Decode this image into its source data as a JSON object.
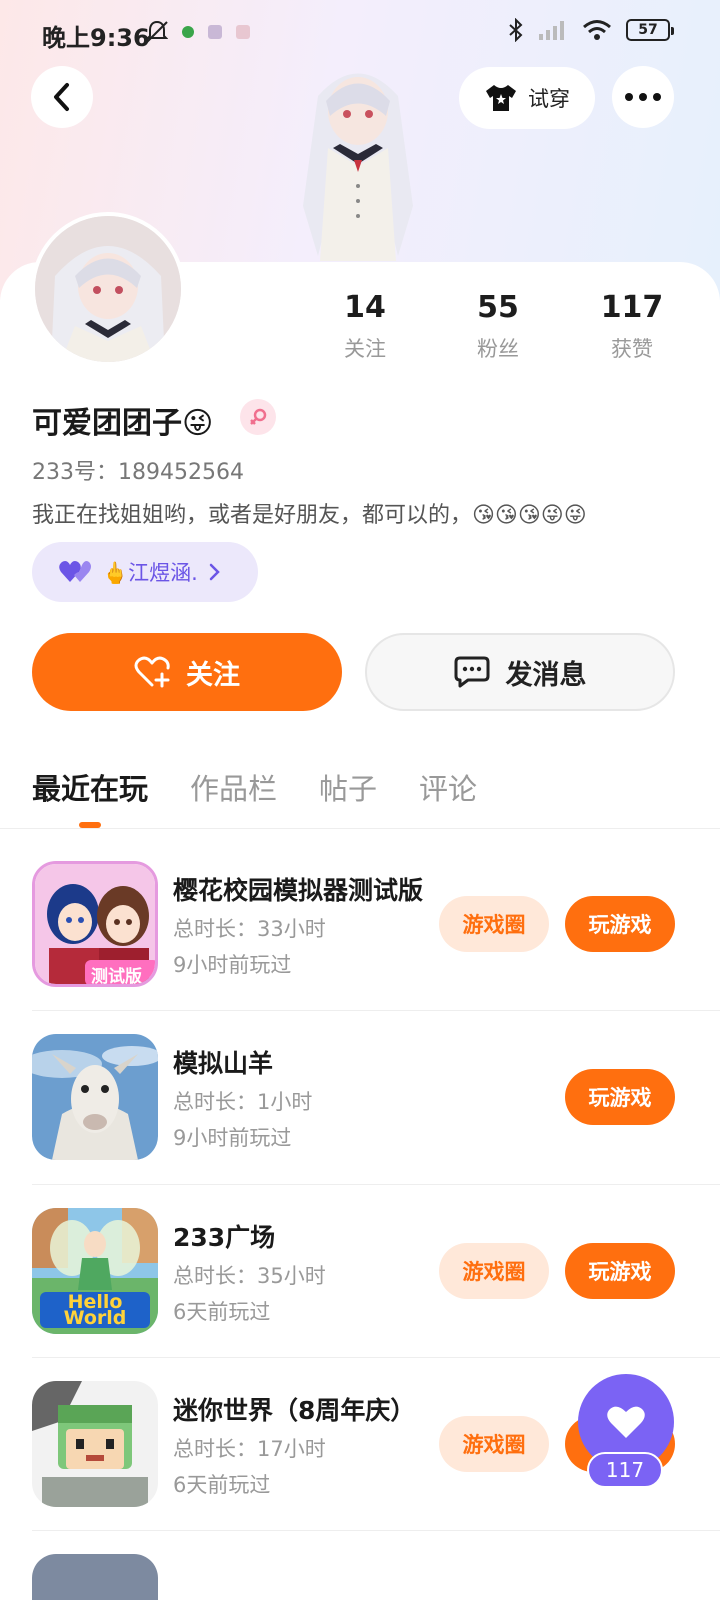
{
  "status_bar": {
    "time": "晚上9:36",
    "battery": "57"
  },
  "header": {
    "tryon_label": "试穿"
  },
  "profile": {
    "nickname": "可爱团团子😜",
    "account_id": "233号：189452564",
    "bio": "我正在找姐姐哟，或者是好朋友，都可以的，😘😘😘😜😜",
    "cp_tag": "🖕江煜涵."
  },
  "stats": [
    {
      "value": "14",
      "label": "关注"
    },
    {
      "value": "55",
      "label": "粉丝"
    },
    {
      "value": "117",
      "label": "获赞"
    }
  ],
  "actions": {
    "follow_label": "关注",
    "message_label": "发消息"
  },
  "tabs": [
    {
      "label": "最近在玩",
      "active": true
    },
    {
      "label": "作品栏",
      "active": false
    },
    {
      "label": "帖子",
      "active": false
    },
    {
      "label": "评论",
      "active": false
    }
  ],
  "games": [
    {
      "title": "樱花校园模拟器测试版",
      "duration": "总时长：33小时",
      "last_played": "9小时前玩过",
      "circle_label": "游戏圈",
      "play_label": "玩游戏",
      "icon_text": "测试版"
    },
    {
      "title": "模拟山羊",
      "duration": "总时长：1小时",
      "last_played": "9小时前玩过",
      "play_label": "玩游戏"
    },
    {
      "title": "233广场",
      "duration": "总时长：35小时",
      "last_played": "6天前玩过",
      "circle_label": "游戏圈",
      "play_label": "玩游戏",
      "icon_text": "Hello World"
    },
    {
      "title": "迷你世界（8周年庆）",
      "duration": "总时长：17小时",
      "last_played": "6天前玩过",
      "circle_label": "游戏圈",
      "play_label": "玩游戏"
    }
  ],
  "like_fab": {
    "count": "117"
  },
  "colors": {
    "accent": "#ff6f0f",
    "accent_light": "#ffe8d9",
    "purple": "#7b63f4",
    "cp_bg": "#ece8fb"
  }
}
